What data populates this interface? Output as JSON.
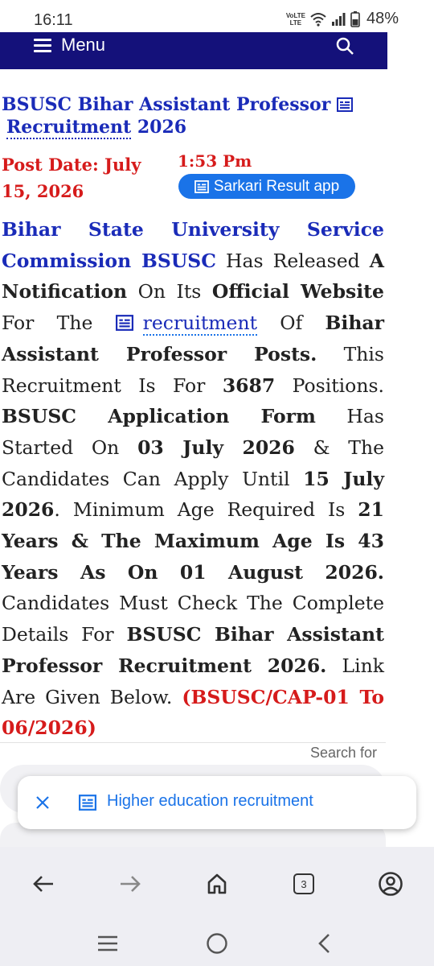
{
  "status_bar": {
    "time": "16:11",
    "volte_line1": "VoLTE",
    "volte_line2": "LTE",
    "battery_percent": "48%"
  },
  "site_nav": {
    "menu_label": "Menu"
  },
  "article": {
    "title_part1": "BSUSC Bihar Assistant Professor",
    "title_part2": "Recruitment",
    "title_part3": " 2026",
    "post_date": "Post Date: July 15, 2026",
    "post_time": "1:53 Pm",
    "app_button_label": "Sarkari Result app",
    "body": {
      "s1": "Bihar State University Service Commission BSUSC",
      "s2": " Has Released ",
      "s3": "A Notification",
      "s4": " On Its ",
      "s5": "Official Website",
      "s6": " For The ",
      "s7": "recruitment",
      "s8": " Of ",
      "s9": "Bihar Assistant Professor Posts.",
      "s10": " This Recruitment Is For ",
      "s11": "3687",
      "s12": " Positions. ",
      "s13": "BSUSC Application Form",
      "s14": " Has Started On ",
      "s15": "03 July 2026",
      "s16": " & The Candidates Can Apply Until ",
      "s17": "15 July 2026",
      "s18": ". Minimum Age Required Is ",
      "s19": "21 Years & The Maximum Age Is 43 Years As On 01 August 2026.",
      "s20": " Candidates Must Check The Complete Details For ",
      "s21": "BSUSC Bihar Assistant Professor Recruitment 2026.",
      "s22": " Link Are Given Below. ",
      "s23": "(BSUSC/CAP-01 To 06/2026)"
    }
  },
  "search_for_label": "Search for",
  "suggestion_chip": {
    "label": "Higher education recruitment"
  },
  "browser_toolbar": {
    "tab_count": "3"
  },
  "colors": {
    "nav_bg": "#14117a",
    "title_blue": "#1a2bb8",
    "date_red": "#d61b1b",
    "accent": "#1a73e8"
  }
}
